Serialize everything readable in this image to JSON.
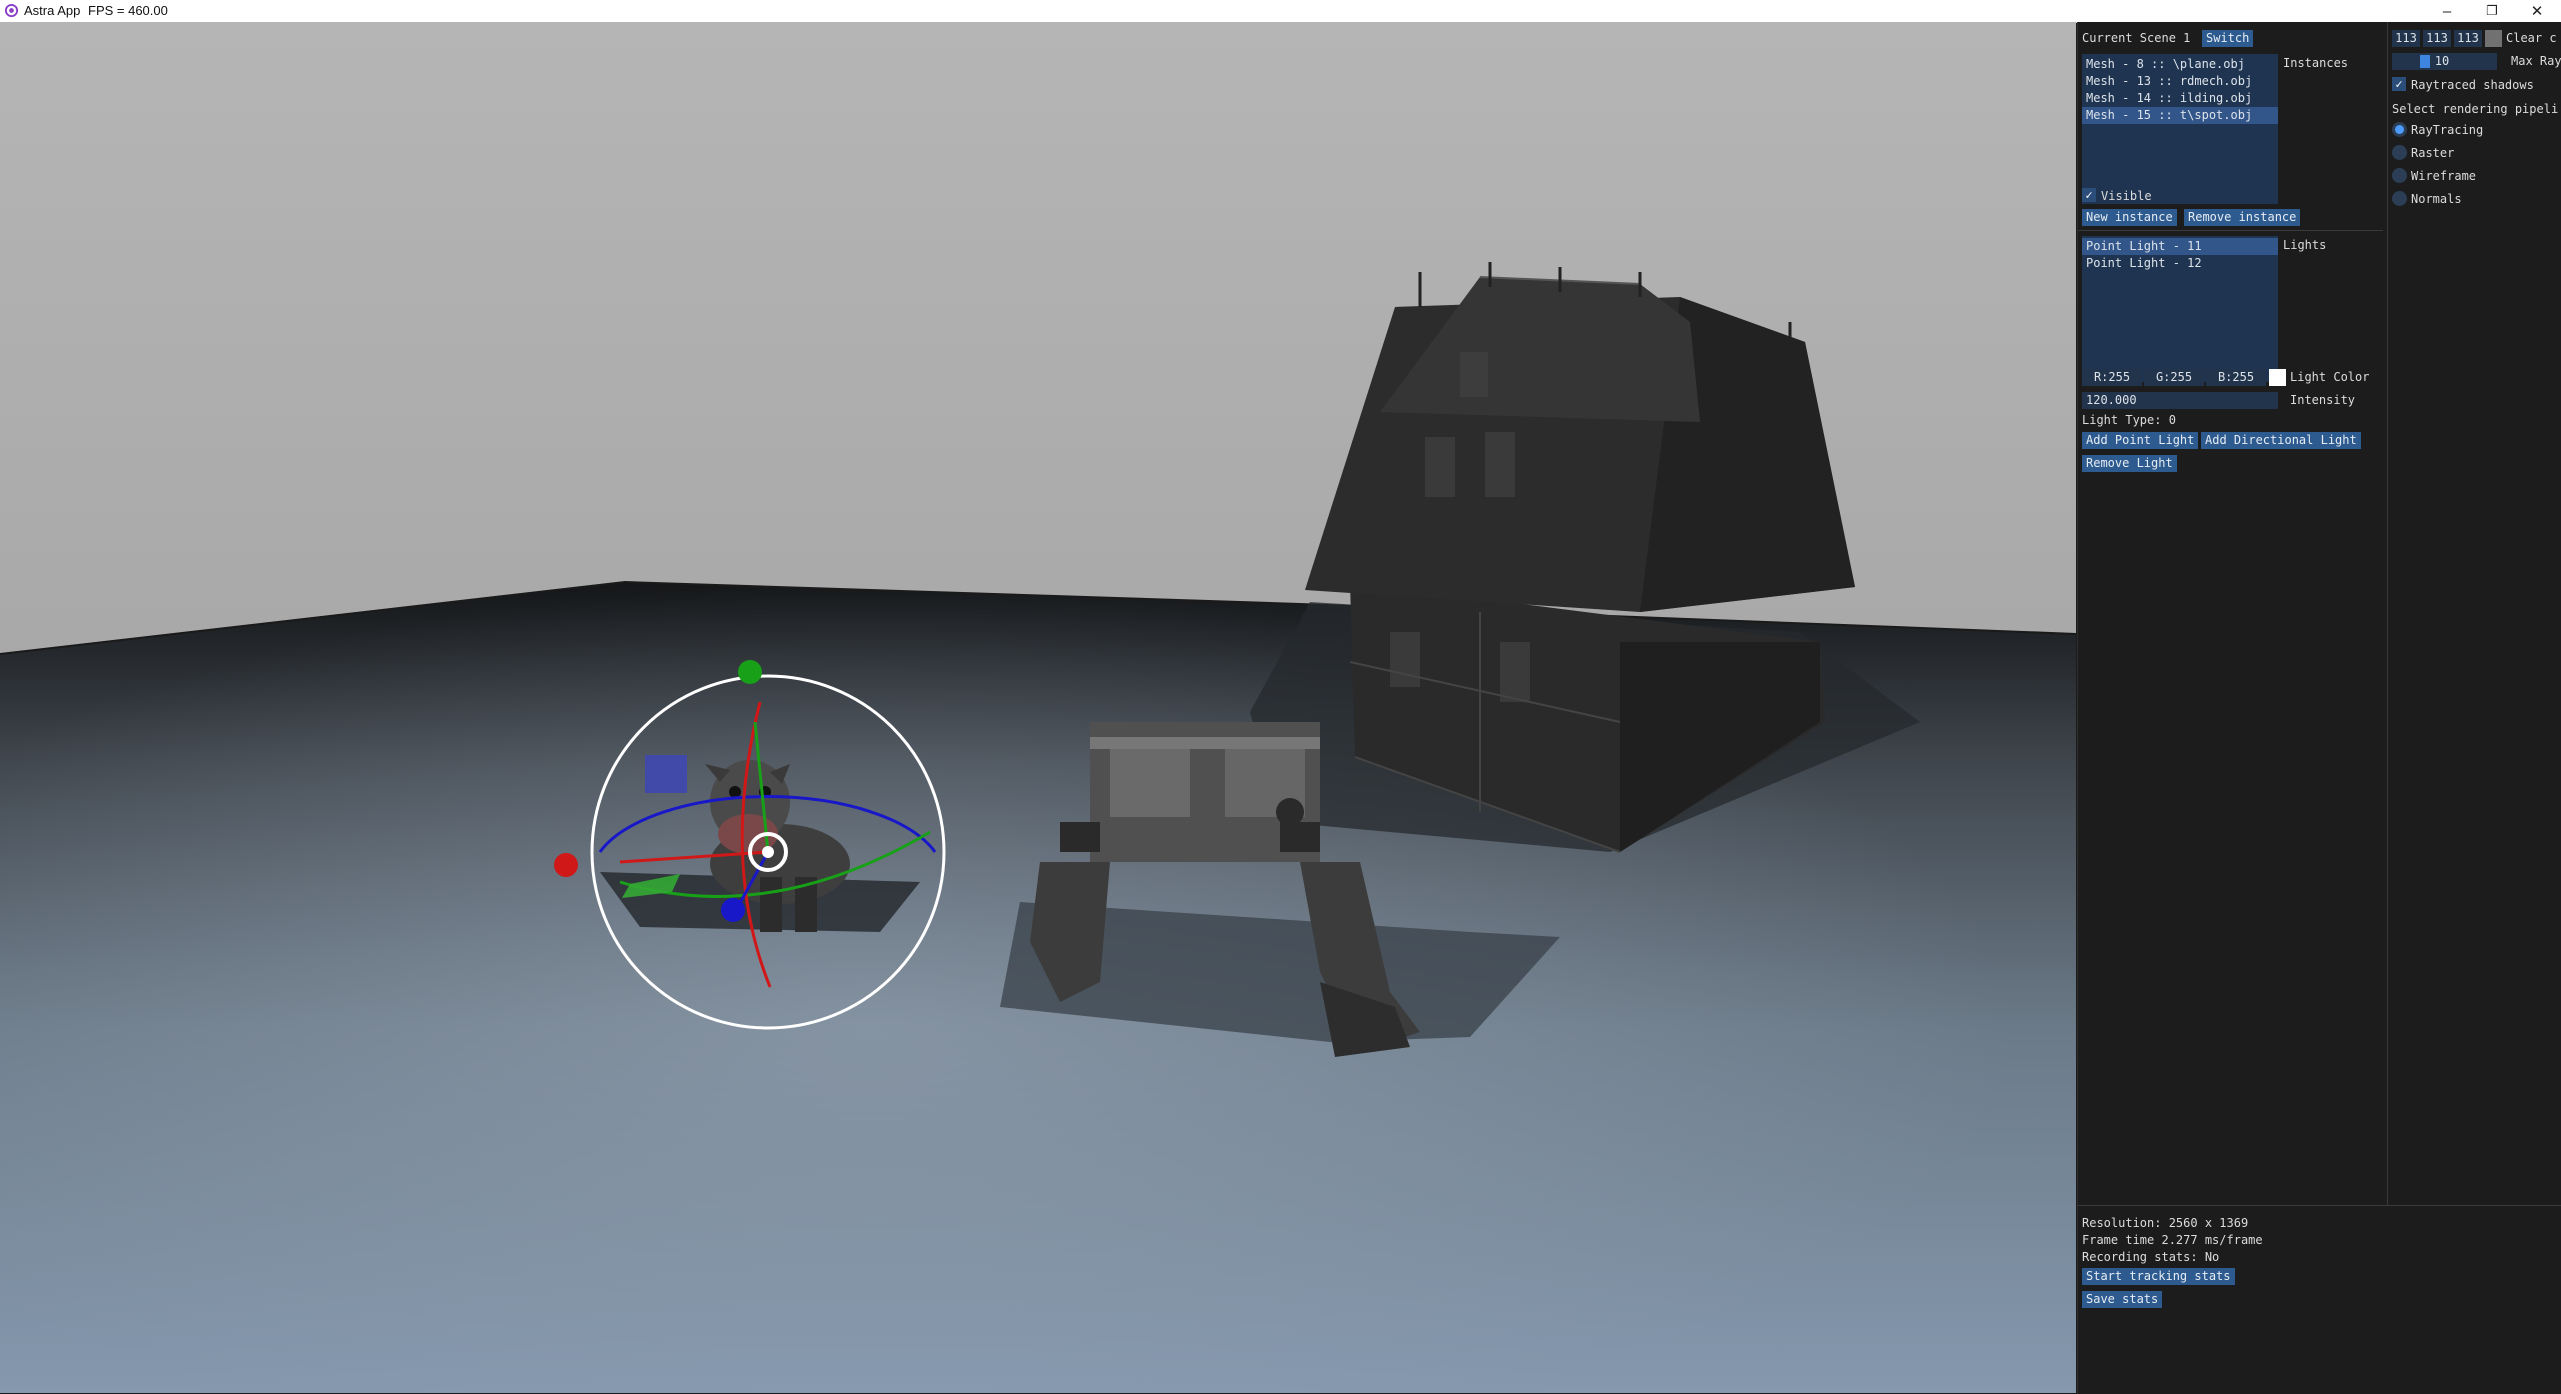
{
  "window": {
    "title": "Astra App",
    "fps": "FPS = 460.00"
  },
  "scene_panel": {
    "current_scene": "Current Scene 1",
    "switch_label": "Switch",
    "instances_label": "Instances",
    "instances": [
      "Mesh - 8 :: \\plane.obj",
      "Mesh - 13 :: rdmech.obj",
      "Mesh - 14 :: ilding.obj",
      "Mesh - 15 :: t\\spot.obj"
    ],
    "selected_instance": 3,
    "visible_label": "Visible",
    "visible_checked": true,
    "new_instance_label": "New instance",
    "remove_instance_label": "Remove instance",
    "lights_label": "Lights",
    "lights": [
      "Point Light - 11",
      "Point Light - 12"
    ],
    "selected_light": 0,
    "color_r": "R:255",
    "color_g": "G:255",
    "color_b": "B:255",
    "light_color_label": "Light Color",
    "light_color_hex": "#ffffff",
    "intensity_value": "120.000",
    "intensity_label": "Intensity",
    "light_type": "Light Type: 0",
    "add_point_light_label": "Add Point Light",
    "add_directional_light_label": "Add Directional Light",
    "remove_light_label": "Remove Light"
  },
  "render_panel": {
    "clear_r": "113",
    "clear_g": "113",
    "clear_b": "113",
    "clear_color_hex": "#717171",
    "clear_label": "Clear c",
    "max_rays_value": "10",
    "max_rays_fraction": 0.3,
    "max_rays_label": "Max Ray",
    "raytraced_shadows_label": "Raytraced shadows",
    "raytraced_shadows_checked": true,
    "pipeline_label": "Select rendering pipeli",
    "pipelines": [
      "RayTracing",
      "Raster",
      "Wireframe",
      "Normals"
    ],
    "selected_pipeline": 0
  },
  "stats_panel": {
    "resolution": "Resolution: 2560 x 1369",
    "frame_time": "Frame time 2.277 ms/frame",
    "recording": "Recording stats: No",
    "start_tracking_label": "Start tracking stats",
    "save_stats_label": "Save stats"
  },
  "colors": {
    "accent": "#2e5b8f",
    "list_bg": "#1e3450",
    "selected": "#32558a",
    "gizmo_x": "#d01818",
    "gizmo_y": "#18a018",
    "gizmo_z": "#1818c8"
  }
}
